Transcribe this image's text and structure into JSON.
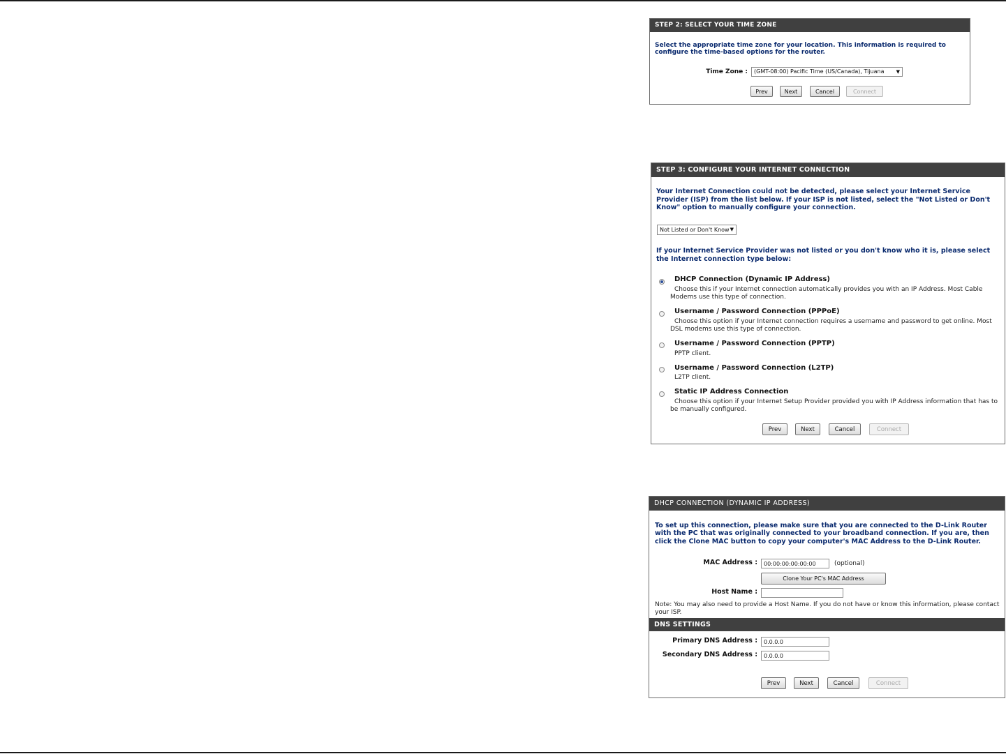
{
  "step2": {
    "title": "STEP 2: SELECT YOUR TIME ZONE",
    "intro": "Select the appropriate time zone for your location. This information is required to configure the time-based options for the router.",
    "timezone_label": "Time Zone :",
    "timezone_value": "(GMT-08:00) Pacific Time (US/Canada), Tijuana",
    "buttons": {
      "prev": "Prev",
      "next": "Next",
      "cancel": "Cancel",
      "connect": "Connect"
    }
  },
  "step3": {
    "title": "STEP 3: CONFIGURE YOUR INTERNET CONNECTION",
    "intro": "Your Internet Connection could not be detected, please select your Internet Service Provider (ISP) from the list below. If your ISP is not listed, select the \"Not Listed or Don't Know\" option to manually configure your connection.",
    "isp_select_value": "Not Listed or Don't Know",
    "type_prompt": "If your Internet Service Provider was not listed or you don't know who it is, please select the Internet connection type below:",
    "options": [
      {
        "title": "DHCP Connection (Dynamic IP Address)",
        "desc": "Choose this if your Internet connection automatically provides you with an IP Address. Most Cable Modems use this type of connection.",
        "checked": true
      },
      {
        "title": "Username / Password Connection (PPPoE)",
        "desc": "Choose this option if your Internet connection requires a username and password to get online. Most DSL modems use this type of connection.",
        "checked": false
      },
      {
        "title": "Username / Password Connection (PPTP)",
        "desc": "PPTP client.",
        "checked": false
      },
      {
        "title": "Username / Password Connection (L2TP)",
        "desc": "L2TP client.",
        "checked": false
      },
      {
        "title": "Static IP Address Connection",
        "desc": "Choose this option if your Internet Setup Provider provided you with IP Address information that has to be manually configured.",
        "checked": false
      }
    ],
    "buttons": {
      "prev": "Prev",
      "next": "Next",
      "cancel": "Cancel",
      "connect": "Connect"
    }
  },
  "dhcp": {
    "title": "DHCP CONNECTION (DYNAMIC IP ADDRESS)",
    "intro": "To set up this connection, please make sure that you are connected to the D-Link Router with the PC that was originally connected to your broadband connection. If you are, then click the Clone MAC button to copy your computer's MAC Address to the D-Link Router.",
    "mac_label": "MAC Address :",
    "mac_value": "00:00:00:00:00:00",
    "mac_optional": "(optional)",
    "clone_button": "Clone Your PC's MAC Address",
    "host_label": "Host Name :",
    "host_value": "",
    "note": "Note: You may also need to provide a Host Name. If you do not have or know this information, please contact your ISP.",
    "dns_title": "DNS SETTINGS",
    "primary_dns_label": "Primary DNS Address :",
    "primary_dns_value": "0.0.0.0",
    "secondary_dns_label": "Secondary DNS Address :",
    "secondary_dns_value": "0.0.0.0",
    "buttons": {
      "prev": "Prev",
      "next": "Next",
      "cancel": "Cancel",
      "connect": "Connect"
    }
  }
}
